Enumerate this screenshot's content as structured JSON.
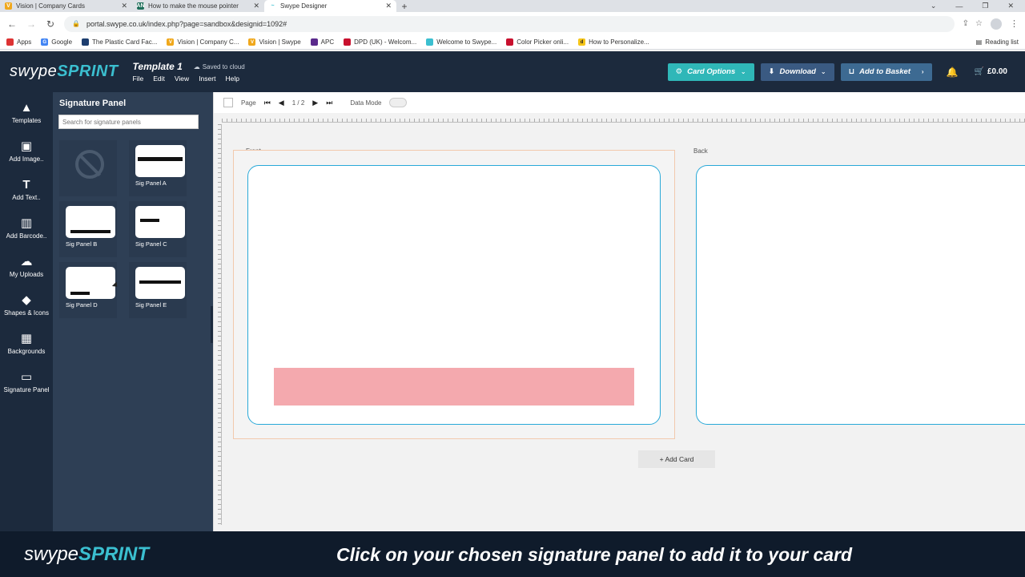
{
  "browser": {
    "tabs": [
      {
        "title": "Vision | Company Cards",
        "fav": "V",
        "color": "#f0a81c",
        "active": false
      },
      {
        "title": "How to make the mouse pointer",
        "fav": "AN",
        "color": "#1f6f5b",
        "active": false
      },
      {
        "title": "Swype Designer",
        "fav": "~",
        "color": "#3bbfd0",
        "active": true
      }
    ],
    "url": "portal.swype.co.uk/index.php?page=sandbox&designid=1092#",
    "bookmarks": [
      {
        "label": "Apps",
        "color": "#d33"
      },
      {
        "label": "Google",
        "color": "#4285f4"
      },
      {
        "label": "The Plastic Card Fac...",
        "color": "#1c3d6e"
      },
      {
        "label": "Vision | Company C...",
        "color": "#f0a81c"
      },
      {
        "label": "Vision | Swype",
        "color": "#f0a81c"
      },
      {
        "label": "APC",
        "color": "#5a2a8c"
      },
      {
        "label": "DPD (UK) - Welcom...",
        "color": "#c8102e"
      },
      {
        "label": "Welcome to Swype...",
        "color": "#3bbfd0"
      },
      {
        "label": "Color Picker onli...",
        "color": "#c8102e"
      },
      {
        "label": "How to Personalize...",
        "color": "#f5c518"
      }
    ],
    "reading_list": "Reading list"
  },
  "header": {
    "logo_a": "swype",
    "logo_b": "SPRINT",
    "template_title": "Template 1",
    "saved": "Saved to cloud",
    "menu": [
      "File",
      "Edit",
      "View",
      "Insert",
      "Help"
    ],
    "card_options": "Card Options",
    "download": "Download",
    "add_to_basket": "Add to Basket",
    "cart_total": "£0.00"
  },
  "rail": [
    {
      "label": "Templates",
      "icon": "▲"
    },
    {
      "label": "Add Image..",
      "icon": "▣"
    },
    {
      "label": "Add Text..",
      "icon": "T"
    },
    {
      "label": "Add Barcode..",
      "icon": "▥"
    },
    {
      "label": "My Uploads",
      "icon": "☁"
    },
    {
      "label": "Shapes & Icons",
      "icon": "◆"
    },
    {
      "label": "Backgrounds",
      "icon": "▦"
    },
    {
      "label": "Signature Panel",
      "icon": "▭"
    }
  ],
  "panel": {
    "title": "Signature Panel",
    "search_placeholder": "Search for signature panels",
    "items": [
      {
        "label": ""
      },
      {
        "label": "Sig Panel A"
      },
      {
        "label": "Sig Panel B"
      },
      {
        "label": "Sig Panel C"
      },
      {
        "label": "Sig Panel D"
      },
      {
        "label": "Sig Panel E"
      }
    ]
  },
  "toolbar": {
    "page_label": "Page",
    "page_counter": "1 / 2",
    "data_mode": "Data Mode"
  },
  "canvas": {
    "front_label": "Front",
    "back_label": "Back",
    "add_card": "+ Add Card",
    "signature_strip_color": "#f4a9ae",
    "card_border_color": "#29a9d8"
  },
  "footer": {
    "logo_a": "swype",
    "logo_b": "SPRINT",
    "caption": "Click on your chosen signature panel to add it to your card"
  }
}
